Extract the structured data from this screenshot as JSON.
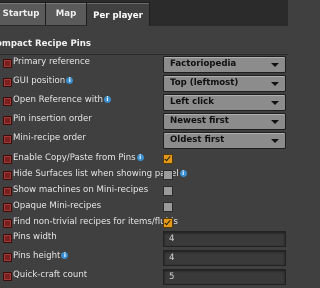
{
  "tabs": [
    {
      "label": "Startup"
    },
    {
      "label": "Map"
    },
    {
      "label": "Per player"
    }
  ],
  "section": {
    "title": "ompact Recipe Pins"
  },
  "settings": [
    {
      "label": "Primary reference",
      "info": false,
      "type": "dropdown",
      "value": "Factoriopedia"
    },
    {
      "label": "GUI position",
      "info": true,
      "type": "dropdown",
      "value": "Top (leftmost)"
    },
    {
      "label": "Open Reference with",
      "info": true,
      "type": "dropdown",
      "value": "Left click"
    },
    {
      "label": "Pin insertion order",
      "info": false,
      "type": "dropdown",
      "value": "Newest first"
    },
    {
      "label": "Mini-recipe order",
      "info": false,
      "type": "dropdown",
      "value": "Oldest first"
    },
    {
      "label": "Enable Copy/Paste from Pins",
      "info": true,
      "type": "checkbox",
      "checked": true
    },
    {
      "label": "Hide Surfaces list when showing panel",
      "info": true,
      "type": "checkbox",
      "checked": false
    },
    {
      "label": "Show machines on Mini-recipes",
      "info": false,
      "type": "checkbox",
      "checked": false
    },
    {
      "label": "Opaque Mini-recipes",
      "info": false,
      "type": "checkbox",
      "checked": false
    },
    {
      "label": "Find non-trivial recipes for items/fluids",
      "info": false,
      "type": "checkbox",
      "checked": true
    },
    {
      "label": "Pins width",
      "info": false,
      "type": "number",
      "value": "4"
    },
    {
      "label": "Pins height",
      "info": true,
      "type": "number",
      "value": "4"
    },
    {
      "label": "Quick-craft count",
      "info": false,
      "type": "number",
      "value": "5"
    }
  ],
  "icons": {
    "info": "i"
  },
  "colors": {
    "checkbox_on": "#e39a1a",
    "dropdown_bg": "#8c8c8c",
    "panel_bg": "#404040"
  }
}
